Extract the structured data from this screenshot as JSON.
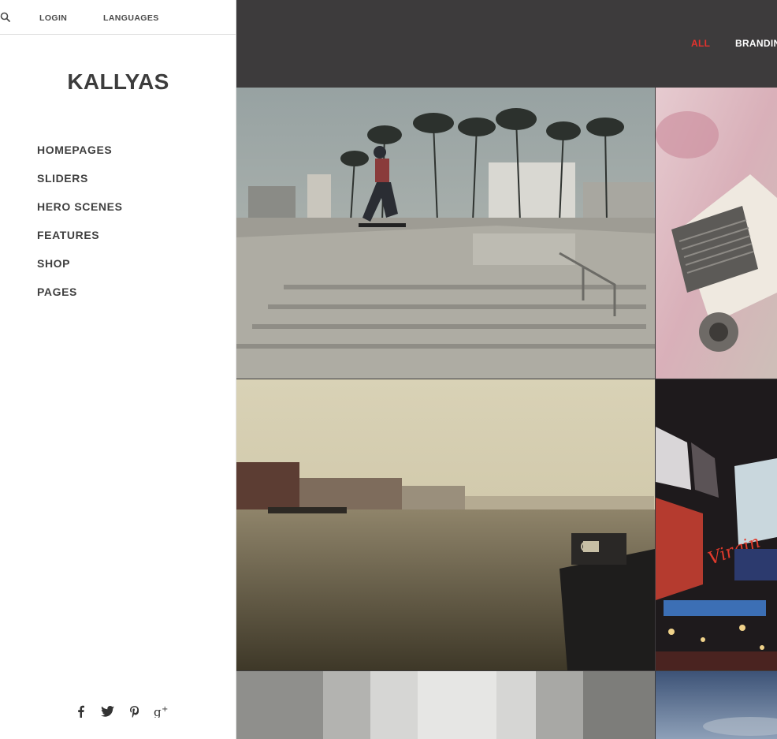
{
  "topbar": {
    "login": "LOGIN",
    "languages": "LANGUAGES",
    "search_icon": "search-icon"
  },
  "logo": "KALLYAS",
  "menu": [
    {
      "label": "HOMEPAGES"
    },
    {
      "label": "SLIDERS"
    },
    {
      "label": "HERO SCENES"
    },
    {
      "label": "FEATURES"
    },
    {
      "label": "SHOP"
    },
    {
      "label": "PAGES"
    }
  ],
  "social": [
    "facebook-icon",
    "twitter-icon",
    "pinterest-icon",
    "google-plus-icon"
  ],
  "filters": {
    "all": "ALL",
    "branding": "BRANDING"
  },
  "colors": {
    "accent": "#e5322d",
    "main_bg": "#3d3b3c",
    "text": "#3f3f3f"
  },
  "portfolio": [
    {
      "name": "skateboarder-photo"
    },
    {
      "name": "vintage-camera-photo"
    },
    {
      "name": "harbor-boat-photo"
    },
    {
      "name": "city-billboards-photo"
    },
    {
      "name": "foggy-street-photo"
    },
    {
      "name": "sky-photo"
    }
  ]
}
